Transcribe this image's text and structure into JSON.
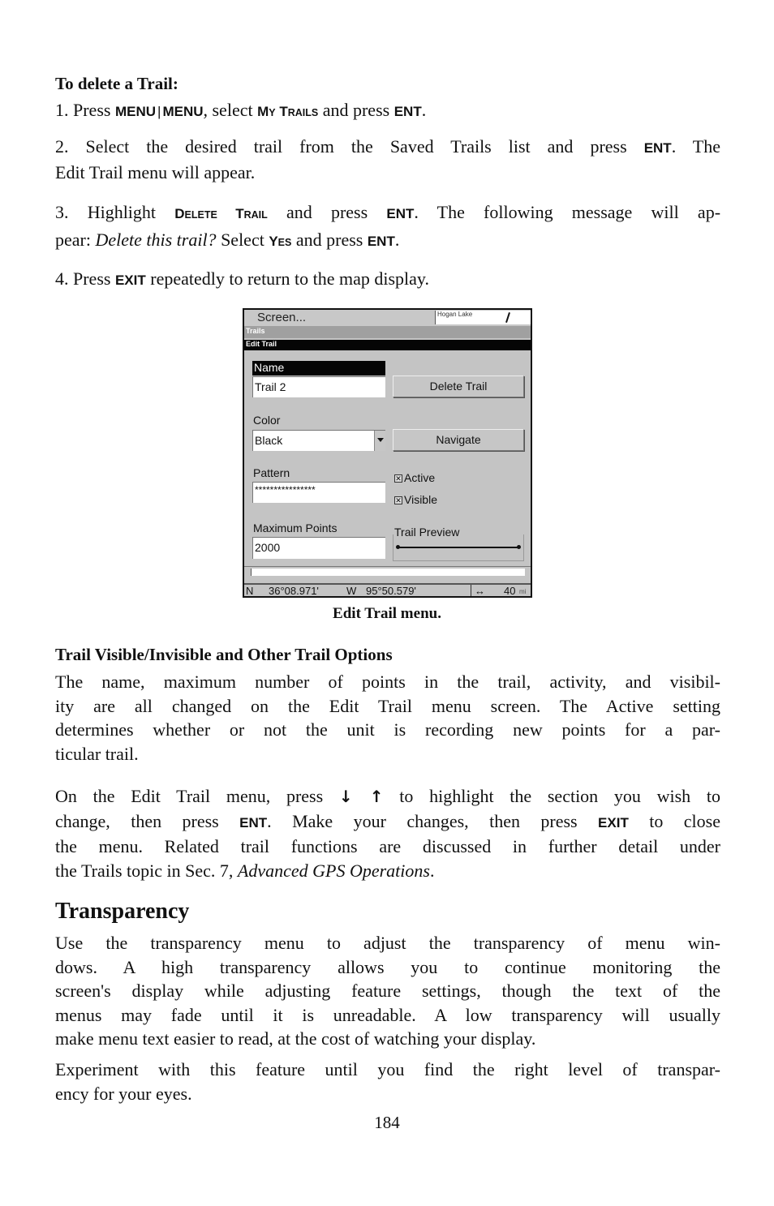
{
  "delete_section": {
    "heading": "To delete a Trail:",
    "step1": {
      "prefix": "1. Press ",
      "key1": "MENU",
      "sep": "|",
      "key2": "MENU",
      "mid": ", select ",
      "menu_item_big1": "M",
      "menu_item_small1": "Y",
      "menu_item_big2": " T",
      "menu_item_small2": "RAILS",
      "mid2": " and press ",
      "key3": "ENT",
      "suffix": "."
    },
    "step2": {
      "text": "2. Select the desired trail from the Saved Trails list and press ",
      "key": "ENT",
      "suffix": ". The",
      "line2": "Edit Trail menu will appear."
    },
    "step3": {
      "prefix": "3. Highlight ",
      "item_big1": "D",
      "item_small1": "ELETE",
      "item_big2": " T",
      "item_small2": "RAIL",
      "mid": " and press ",
      "key": "ENT",
      "mid2": ". The following message will ap-",
      "line2_prefix": "pear: ",
      "line2_italic": "Delete this trail?",
      "line2_mid": " Select ",
      "yes_big": "Y",
      "yes_small": "ES",
      "line2_mid2": " and press ",
      "key2": "ENT",
      "suffix": "."
    },
    "step4": {
      "prefix": "4. Press ",
      "key": "EXIT",
      "suffix": " repeatedly to return to the map display."
    }
  },
  "device_screen": {
    "top_label": "Screen...",
    "map_label": "Hogan Lake",
    "menu_bar": "Trails",
    "submenu_bar": "Edit Trail",
    "name_label": "Name",
    "name_value": "Trail 2",
    "delete_button": "Delete Trail",
    "color_label": "Color",
    "color_value": "Black",
    "navigate_button": "Navigate",
    "pattern_label": "Pattern",
    "pattern_value": "****************",
    "active_label": "Active",
    "active_checked": true,
    "visible_label": "Visible",
    "visible_checked": true,
    "check_mark": "✕",
    "max_points_label": "Maximum Points",
    "max_points_value": "2000",
    "trail_preview_label": "Trail Preview",
    "status": {
      "lat_hemi": "N",
      "lat": "36°08.971'",
      "lon_hemi": "W",
      "lon": "95°50.579'",
      "zoom_icon": "↔",
      "zoom_value": "40",
      "zoom_unit": "mi"
    }
  },
  "caption": "Edit Trail menu.",
  "options_section": {
    "heading": "Trail Visible/Invisible and Other Trail Options",
    "para1": [
      "The name, maximum number of points in the trail, activity, and visibil-",
      "ity are all changed on the Edit Trail menu screen. The Active setting",
      "determines whether or not the unit is recording new points for a par-",
      "ticular trail."
    ],
    "para2": {
      "line1_prefix": "On the Edit Trail menu, press ",
      "arrows": "↓ ↑",
      "line1_suffix": " to highlight the section you wish to",
      "line2_prefix": "change, then press ",
      "key1": "ENT",
      "line2_mid": ". Make your changes, then press ",
      "key2": "EXIT",
      "line2_suffix": " to close",
      "line3": "the menu. Related trail functions are discussed in further detail under",
      "line4_prefix": "the Trails topic in Sec. 7, ",
      "line4_italic": "Advanced GPS Operations",
      "line4_suffix": "."
    }
  },
  "transparency_section": {
    "heading": "Transparency",
    "para1": [
      "Use the transparency menu to adjust the transparency of menu win-",
      "dows. A high transparency allows you to continue monitoring the",
      "screen's display while adjusting feature settings, though the text of the",
      "menus may fade until it is unreadable. A low transparency will usually",
      "make menu text easier to read, at the cost of watching your display."
    ],
    "para2": [
      "Experiment with this feature until you find the right level of transpar-",
      "ency for your eyes."
    ]
  },
  "page_number": "184"
}
